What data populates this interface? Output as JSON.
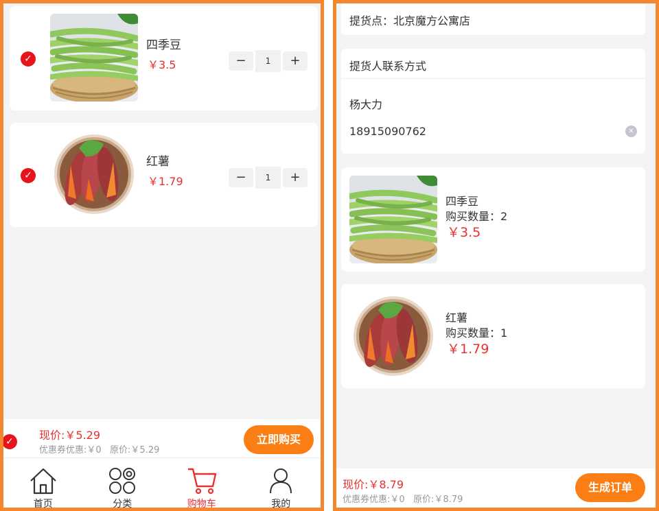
{
  "cart": {
    "items": [
      {
        "name": "四季豆",
        "price": "￥3.5",
        "qty": "1",
        "checked": true,
        "image": "green-beans"
      },
      {
        "name": "红薯",
        "price": "￥1.79",
        "qty": "1",
        "checked": true,
        "image": "sweet-potato"
      }
    ],
    "stepper": {
      "minus": "−",
      "plus": "+"
    },
    "summary": {
      "current_price": "现价:￥5.29",
      "discount_line": "优惠券优惠:￥0   原价:￥5.29",
      "buy_button": "立即购买"
    },
    "tabs": [
      {
        "label": "首页",
        "icon": "home-icon",
        "active": false
      },
      {
        "label": "分类",
        "icon": "category-icon",
        "active": false
      },
      {
        "label": "购物车",
        "icon": "cart-icon",
        "active": true
      },
      {
        "label": "我的",
        "icon": "user-icon",
        "active": false
      }
    ]
  },
  "order": {
    "pickup_point": "提货点：北京魔方公寓店",
    "contact_header": "提货人联系方式",
    "contact_name": "杨大力",
    "contact_phone": "18915090762",
    "items": [
      {
        "name": "四季豆",
        "qty_line": "购买数量：2",
        "price": "￥3.5",
        "image": "green-beans"
      },
      {
        "name": "红薯",
        "qty_line": "购买数量：1",
        "price": "￥1.79",
        "image": "sweet-potato"
      }
    ],
    "summary": {
      "current_price": "现价:￥8.79",
      "discount_line": "优惠券优惠:￥0   原价:￥8.79",
      "submit_button": "生成订单"
    }
  },
  "colors": {
    "accent": "#fb7e14",
    "price": "#e8302f",
    "check": "#e8141c",
    "frame": "#f5872f"
  }
}
